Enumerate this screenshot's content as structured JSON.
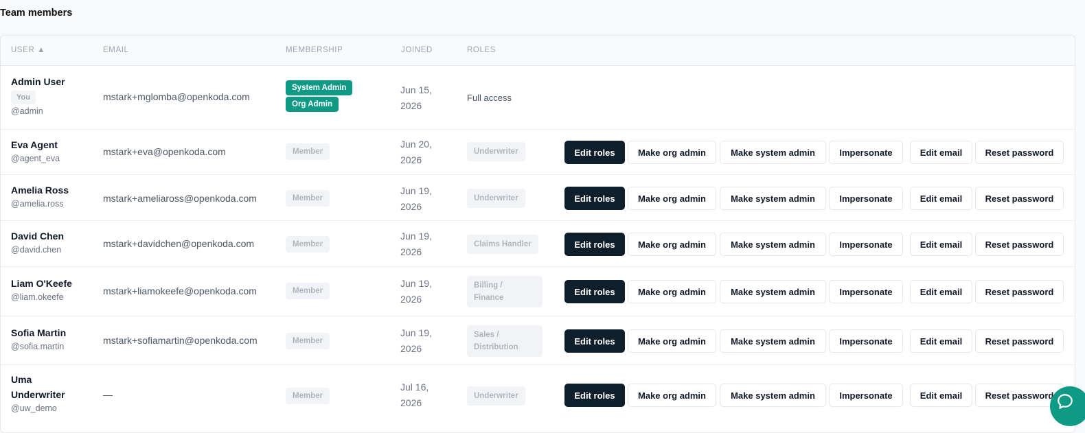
{
  "page_title": "Team members",
  "columns": {
    "user": "USER ▲",
    "email": "EMAIL",
    "membership": "MEMBERSHIP",
    "joined": "JOINED",
    "roles": "ROLES"
  },
  "action_labels": {
    "edit_roles": "Edit roles",
    "make_org_admin": "Make org admin",
    "make_system_admin": "Make system admin",
    "impersonate": "Impersonate",
    "edit_email": "Edit email",
    "reset_password": "Reset password"
  },
  "rows": [
    {
      "name": "Admin User",
      "you_badge": "You",
      "handle": "@admin",
      "email": "mstark+mglomba@openkoda.com",
      "membership": [
        "System Admin",
        "Org Admin"
      ],
      "joined": [
        "Jun 15,",
        "2026"
      ],
      "roles": "Full access"
    },
    {
      "name": "Eva Agent",
      "handle": "@agent_eva",
      "email": "mstark+eva@openkoda.com",
      "membership": [
        "Member"
      ],
      "joined": [
        "Jun 20,",
        "2026"
      ],
      "roles": [
        "Underwriter"
      ]
    },
    {
      "name": "Amelia Ross",
      "handle": "@amelia.ross",
      "email": "mstark+ameliaross@openkoda.com",
      "membership": [
        "Member"
      ],
      "joined": [
        "Jun 19,",
        "2026"
      ],
      "roles": [
        "Underwriter"
      ]
    },
    {
      "name": "David Chen",
      "handle": "@david.chen",
      "email": "mstark+davidchen@openkoda.com",
      "membership": [
        "Member"
      ],
      "joined": [
        "Jun 19,",
        "2026"
      ],
      "roles": [
        "Claims Handler"
      ]
    },
    {
      "name": "Liam O'Keefe",
      "handle": "@liam.okeefe",
      "email": "mstark+liamokeefe@openkoda.com",
      "membership": [
        "Member"
      ],
      "joined": [
        "Jun 19,",
        "2026"
      ],
      "roles": [
        "Billing /",
        "Finance"
      ]
    },
    {
      "name": "Sofia Martin",
      "handle": "@sofia.martin",
      "email": "mstark+sofiamartin@openkoda.com",
      "membership": [
        "Member"
      ],
      "joined": [
        "Jun 19,",
        "2026"
      ],
      "roles": [
        "Sales /",
        "Distribution"
      ]
    },
    {
      "name_lines": [
        "Uma",
        "Underwriter"
      ],
      "handle": "@uw_demo",
      "email": "—",
      "membership": [
        "Member"
      ],
      "joined": [
        "Jul 16,",
        "2026"
      ],
      "roles": [
        "Underwriter"
      ]
    }
  ],
  "chat_button_icon": "chat-bubble-icon",
  "colors": {
    "accent_green": "#0f9a85",
    "dark_button": "#0f1e2b"
  }
}
